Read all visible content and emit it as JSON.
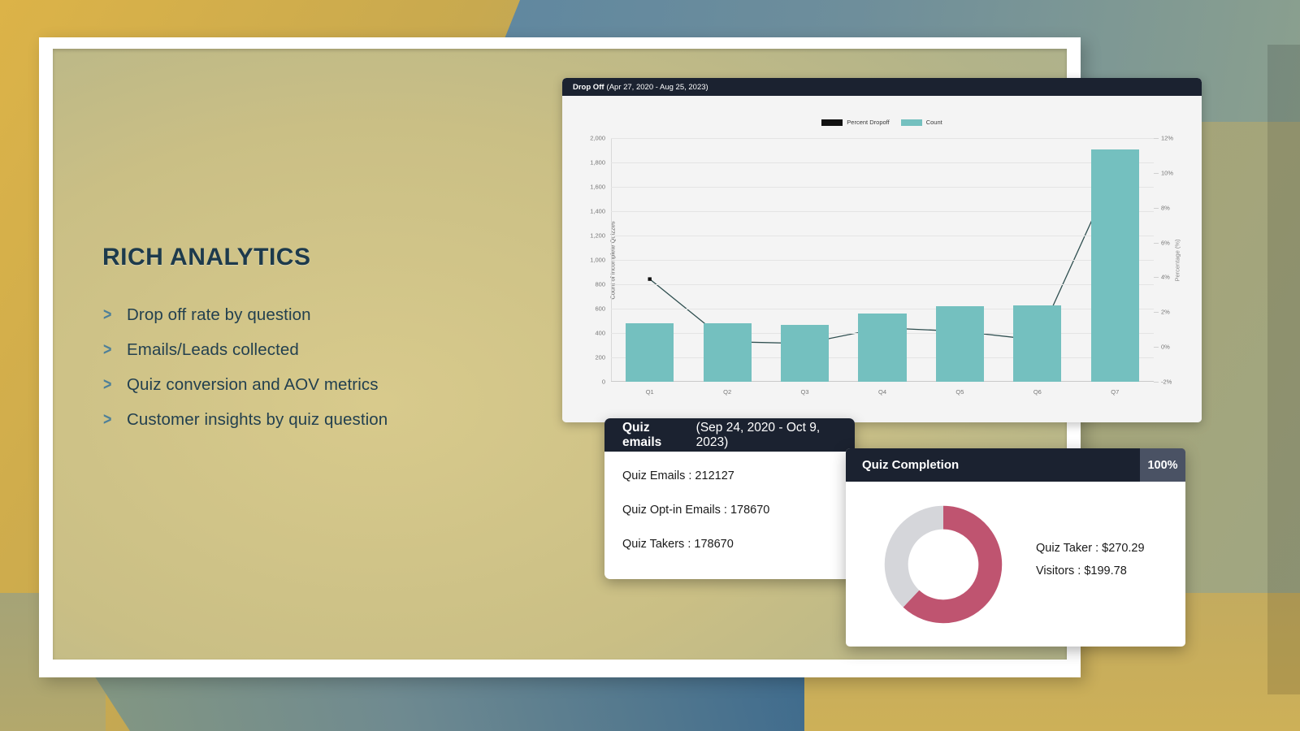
{
  "slide": {
    "title": "RICH ANALYTICS",
    "features": [
      {
        "bullet": ">",
        "label": "Drop off rate by question"
      },
      {
        "bullet": ">",
        "label": "Emails/Leads collected"
      },
      {
        "bullet": ">",
        "label": "Quiz conversion and AOV metrics"
      },
      {
        "bullet": ">",
        "label": "Customer insights by quiz question"
      }
    ]
  },
  "dropoff_card": {
    "title": "Drop Off",
    "date_range": "(Apr 27, 2020 - Aug 25, 2023)"
  },
  "quiz_emails_card": {
    "title": "Quiz emails",
    "date_range": "(Sep 24, 2020 - Oct 9, 2023)",
    "rows": [
      "Quiz Emails : 212127",
      "Quiz Opt-in Emails : 178670",
      "Quiz Takers : 178670"
    ]
  },
  "quiz_completion_card": {
    "title": "Quiz Completion",
    "badge": "100%",
    "stats": [
      "Quiz Taker : $270.29",
      "Visitors : $199.78"
    ],
    "donut": {
      "type": "donut",
      "segments": [
        {
          "name": "Quiz Taker",
          "value": 62,
          "color": "#bf5470"
        },
        {
          "name": "Visitors",
          "value": 38,
          "color": "#d5d6da"
        }
      ]
    }
  },
  "chart_data": {
    "type": "bar",
    "title": "Drop Off",
    "subtitle": "(Apr 27, 2020 - Aug 25, 2023)",
    "categories": [
      "Q1",
      "Q2",
      "Q3",
      "Q4",
      "Q5",
      "Q6",
      "Q7"
    ],
    "xlabel": "",
    "ylabel": "Count of Incomplete Quizzes",
    "ylabel_right": "Percentage (%)",
    "ylim": [
      0,
      2000
    ],
    "yticks": [
      0,
      200,
      400,
      600,
      800,
      1000,
      1200,
      1400,
      1600,
      1800,
      2000
    ],
    "ytick_labels": [
      "0",
      "200",
      "400",
      "600",
      "800",
      "1,000",
      "1,200",
      "1,400",
      "1,600",
      "1,800",
      "2,000"
    ],
    "ylim_right": [
      -2,
      12
    ],
    "yticks_right": [
      -2,
      0,
      2,
      4,
      6,
      8,
      10,
      12
    ],
    "ytick_labels_right": [
      "-2%",
      "0%",
      "2%",
      "4%",
      "6%",
      "8%",
      "10%",
      "12%"
    ],
    "grid": true,
    "legend_position": "top-center",
    "series": [
      {
        "name": "Count",
        "type": "bar",
        "color": "#74c0bf",
        "axis": "left",
        "values": [
          480,
          480,
          470,
          560,
          620,
          630,
          1910
        ]
      },
      {
        "name": "Percent Dropoff",
        "type": "line",
        "color": "#2f4f50",
        "marker_color": "#111111",
        "axis": "right",
        "values": [
          3.9,
          0.3,
          0.2,
          1.1,
          0.9,
          0.4,
          10.2
        ]
      }
    ]
  },
  "colors": {
    "accent_teal": "#74c0bf",
    "header_dark": "#1b2230",
    "title_navy": "#1d3a4c",
    "chevron_blue": "#4d7f99",
    "donut_pink": "#bf5470",
    "donut_gray": "#d5d6da",
    "badge_slate": "#4a5264"
  }
}
